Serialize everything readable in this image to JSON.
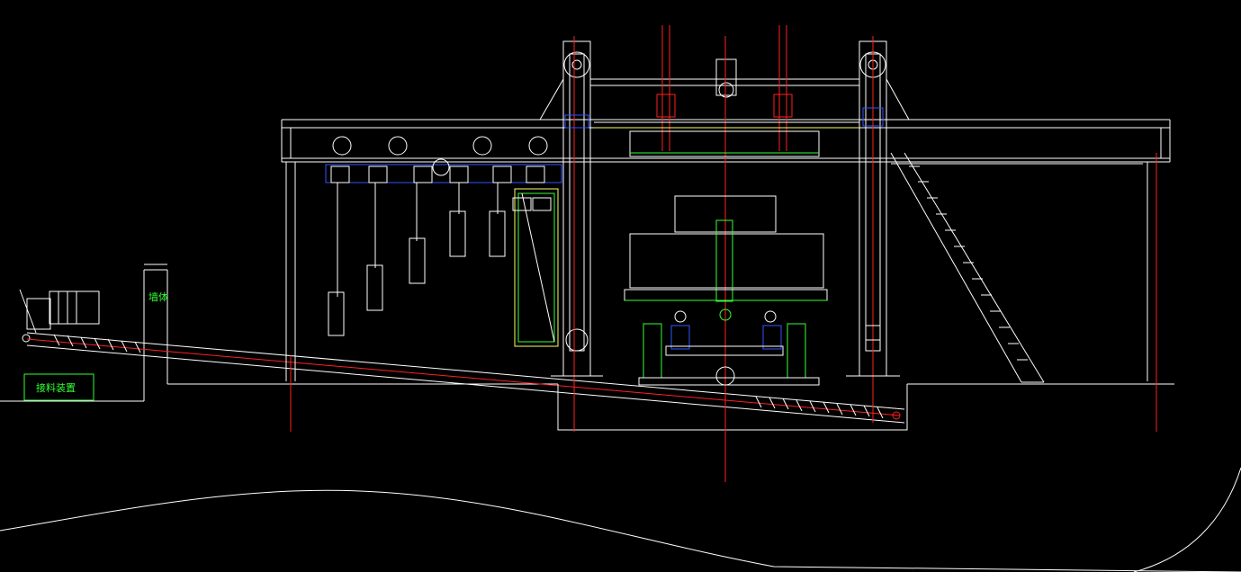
{
  "drawing": {
    "background": "#000000",
    "labels": {
      "wall": "墙体",
      "receiving_device": "接料装置"
    },
    "colors": {
      "line": "#ffffff",
      "centerline": "#ff2020",
      "machine_green": "#33ff33",
      "machine_yellow": "#ffff66",
      "machine_blue": "#3355ff",
      "machine_cyan": "#33ffff",
      "machine_magenta": "#ff33ff"
    }
  }
}
